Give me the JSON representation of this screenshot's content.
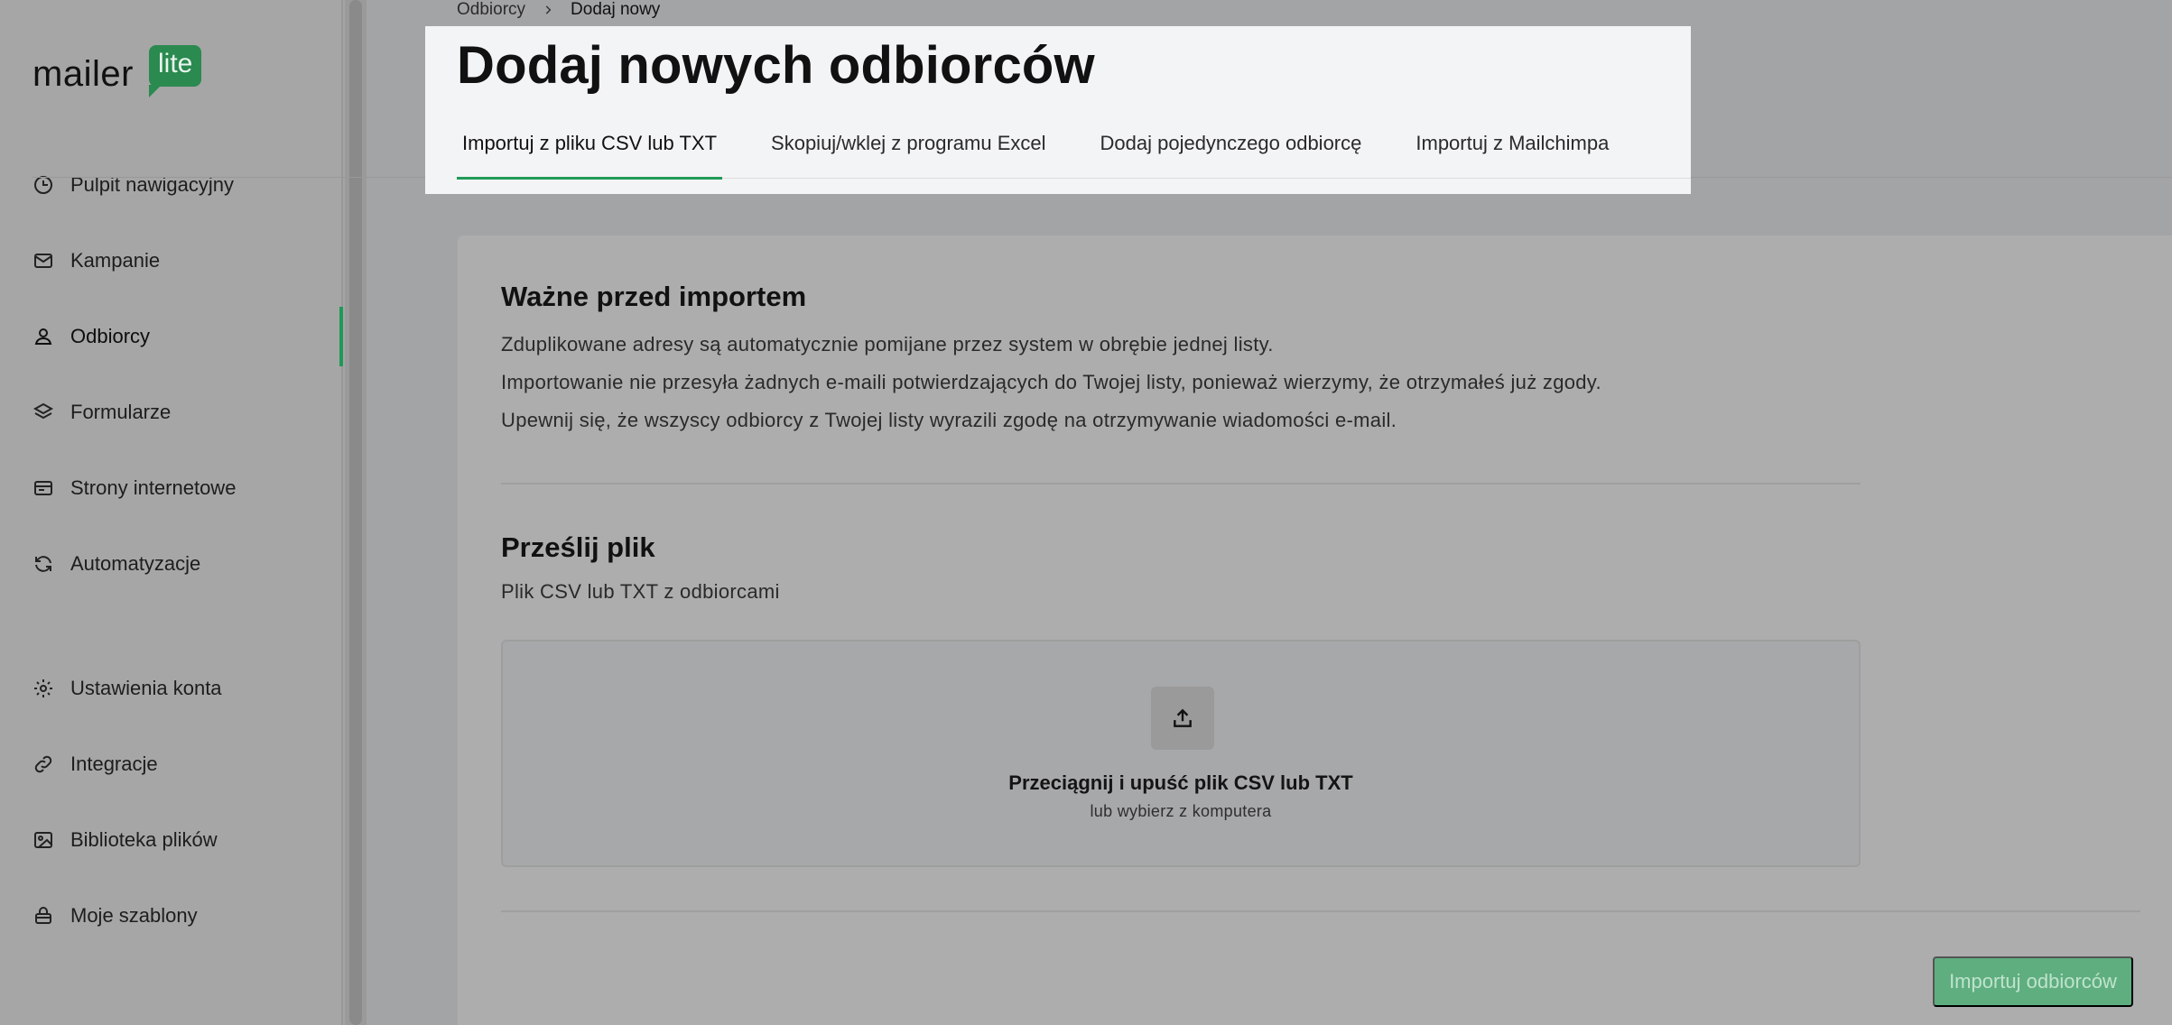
{
  "app": {
    "logo_word": "mailer",
    "logo_badge": "lite",
    "brand_color": "#2a8a4f",
    "accent_color": "#1f9a56"
  },
  "sidebar": {
    "items": [
      {
        "label": "Pulpit nawigacyjny",
        "icon": "dashboard-icon"
      },
      {
        "label": "Kampanie",
        "icon": "mail-icon"
      },
      {
        "label": "Odbiorcy",
        "icon": "user-icon",
        "active": true
      },
      {
        "label": "Formularze",
        "icon": "layers-icon"
      },
      {
        "label": "Strony internetowe",
        "icon": "browser-icon"
      },
      {
        "label": "Automatyzacje",
        "icon": "refresh-icon"
      },
      {
        "label": "Ustawienia konta",
        "icon": "gear-icon"
      },
      {
        "label": "Integracje",
        "icon": "link-icon"
      },
      {
        "label": "Biblioteka plików",
        "icon": "image-icon"
      },
      {
        "label": "Moje szablony",
        "icon": "template-icon"
      }
    ]
  },
  "breadcrumb": {
    "parent": "Odbiorcy",
    "current": "Dodaj nowy"
  },
  "header": {
    "title": "Dodaj nowych odbiorców",
    "tabs": [
      {
        "label": "Importuj z pliku CSV lub TXT",
        "active": true
      },
      {
        "label": "Skopiuj/wklej z programu Excel"
      },
      {
        "label": "Dodaj pojedynczego odbiorcę"
      },
      {
        "label": "Importuj z Mailchimpa"
      }
    ]
  },
  "important": {
    "title": "Ważne przed importem",
    "lines": [
      "Zduplikowane adresy są automatycznie pomijane przez system w obrębie jednej listy.",
      "Importowanie nie przesyła żadnych e-maili potwierdzających do Twojej listy, ponieważ wierzymy, że otrzymałeś już zgody.",
      "Upewnij się, że wszyscy odbiorcy z Twojej listy wyrazili zgodę na otrzymywanie wiadomości e-mail."
    ]
  },
  "upload": {
    "title": "Prześlij plik",
    "subtitle": "Plik CSV lub TXT z odbiorcami",
    "drop_title": "Przeciągnij i upuść plik CSV lub TXT",
    "drop_sub": "lub wybierz z komputera"
  },
  "actions": {
    "import_label": "Importuj odbiorców"
  }
}
